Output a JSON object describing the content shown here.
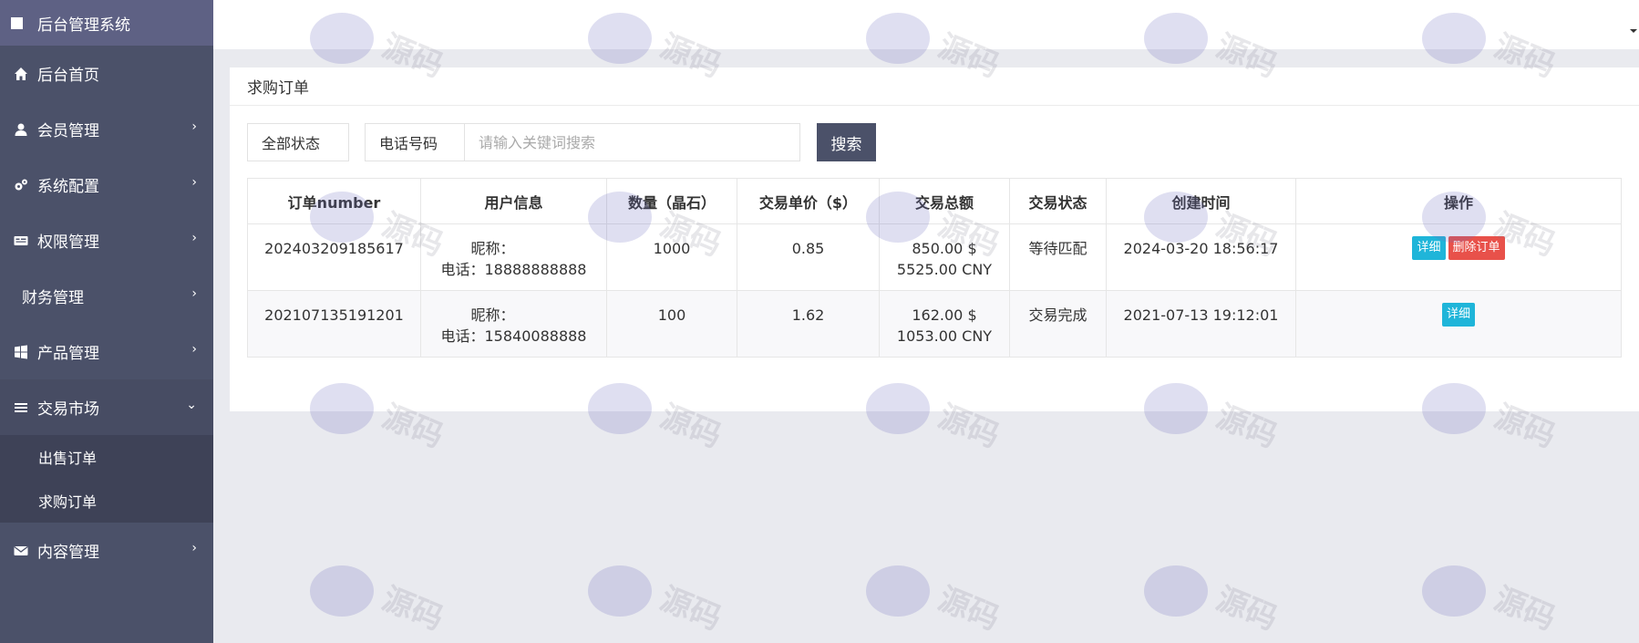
{
  "app": {
    "title": "后台管理系统"
  },
  "sidebar": {
    "items": [
      {
        "label": "后台首页",
        "icon": "home-icon"
      },
      {
        "label": "会员管理",
        "icon": "user-icon"
      },
      {
        "label": "系统配置",
        "icon": "gears-icon"
      },
      {
        "label": "权限管理",
        "icon": "id-card-icon"
      },
      {
        "label": "财务管理",
        "icon": ""
      },
      {
        "label": "产品管理",
        "icon": "windows-icon"
      },
      {
        "label": "交易市场",
        "icon": "bars-icon"
      },
      {
        "label": "内容管理",
        "icon": "envelope-icon"
      }
    ],
    "sub_items": [
      "出售订单",
      "求购订单"
    ]
  },
  "panel": {
    "title": "求购订单"
  },
  "filters": {
    "status": "全部状态",
    "field": "电话号码",
    "search_placeholder": "请输入关键词搜索",
    "search_button": "搜索"
  },
  "table": {
    "headers": [
      "订单number",
      "用户信息",
      "数量（晶石）",
      "交易单价（$）",
      "交易总额",
      "交易状态",
      "创建时间",
      "操作"
    ],
    "rows": [
      {
        "order_no": "202403209185617",
        "nickname": "昵称：",
        "phone": "电话：18888888888",
        "qty": "1000",
        "unit_price": "0.85",
        "total_usd": "850.00 $",
        "total_cny": "5525.00 CNY",
        "status": "等待匹配",
        "created": "2024-03-20 18:56:17",
        "actions": [
          "详细",
          "删除订单"
        ]
      },
      {
        "order_no": "202107135191201",
        "nickname": "昵称：",
        "phone": "电话：15840088888",
        "qty": "100",
        "unit_price": "1.62",
        "total_usd": "162.00 $",
        "total_cny": "1053.00 CNY",
        "status": "交易完成",
        "created": "2021-07-13 19:12:01",
        "actions": [
          "详细"
        ]
      }
    ]
  },
  "watermark": {
    "text": "源码"
  },
  "colors": {
    "sidebar": "#4b5169",
    "brand": "#5e6184",
    "detail": "#1fb5d9",
    "delete": "#e8514a"
  }
}
